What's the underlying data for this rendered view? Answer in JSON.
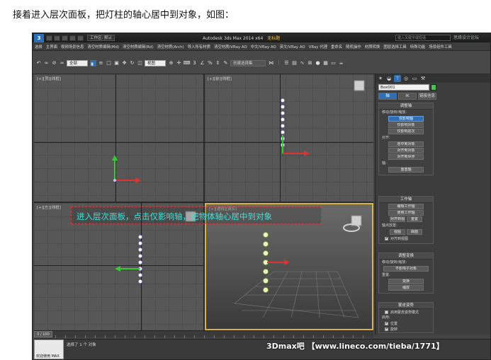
{
  "caption": "接着进入层次面板，把灯柱的轴心居中到对象，如图：",
  "window": {
    "app_title": "Autodesk 3ds Max  2014 x64",
    "file_name": "无标题",
    "workspace": "工作区: 默认",
    "search_placeholder": "键入关键字或短语",
    "watermark_text": "思缘设计论坛"
  },
  "menu": [
    "选择",
    "主界面",
    "视频场景信息",
    "清空材质编辑(Md)",
    "清空材质编辑(Rd)",
    "清空材质(Arch)",
    "导入所有材质",
    "清空材质/VRay AO",
    "中文/VRay AO",
    "英文/VRay AO",
    "VRay 代理",
    "重命名",
    "随机操作",
    "材质转换",
    "图层选择工具",
    "特殊功能",
    "场景组件工具"
  ],
  "toolbar": {
    "selection_filter": "全部",
    "coord_system": "视图",
    "named_selection": "创建选择集"
  },
  "viewports": {
    "top_left_label": "[+][顶][线框]",
    "top_right_label": "[+][前][线框]",
    "bottom_left_label": "[+][左][线框]",
    "bottom_right_label": "[+][透视][真实]"
  },
  "annotation": "进入层次面板，点击仅影响轴，把物体轴心居中到对象",
  "command_panel": {
    "object_name": "Box001",
    "object_color": "#4ec04e",
    "tabs": [
      "轴",
      "IK",
      "链接信息"
    ],
    "adjust_pivot": {
      "title": "调整轴",
      "move_label": "移动/旋转/缩放:",
      "buttons": [
        "仅影响轴",
        "仅影响对象",
        "仅影响层次"
      ],
      "align_label": "对齐:",
      "align_buttons": [
        "居中到对象",
        "对齐到对象",
        "对齐到世界"
      ],
      "axis_label": "轴:",
      "reset_button": "重置轴"
    },
    "working_pivot": {
      "title": "工作轴",
      "buttons": [
        "编辑工作轴",
        "使用工作轴",
        "对齐到视图"
      ],
      "reset_button": "重置",
      "pivot_label": "轴点放置:",
      "view_button": "视图",
      "surface_button": "曲面",
      "align_view_check": "对齐到视图"
    },
    "adjust_transform": {
      "title": "调整变换",
      "move_label": "移动/旋转/缩放:",
      "button": "不影响子对象",
      "reset_label": "重置:",
      "reset_buttons": [
        "变换",
        "缩放"
      ]
    },
    "skin_pose": {
      "title": "蒙皮姿势",
      "enable_label": "启用蒙皮姿势模式",
      "enable_checked": false,
      "on_label": "启用:",
      "checks": [
        {
          "label": "位置",
          "checked": true
        },
        {
          "label": "旋转",
          "checked": true
        },
        {
          "label": "缩放",
          "checked": true
        }
      ]
    }
  },
  "timeline": {
    "frame": "0 / 100"
  },
  "status": {
    "selected": "选择了 1 个 对象",
    "thumb_label": "欢迎使用 MAX",
    "site_watermark": "3Dmax吧 【www.lineco.com/tieba/1771】"
  }
}
